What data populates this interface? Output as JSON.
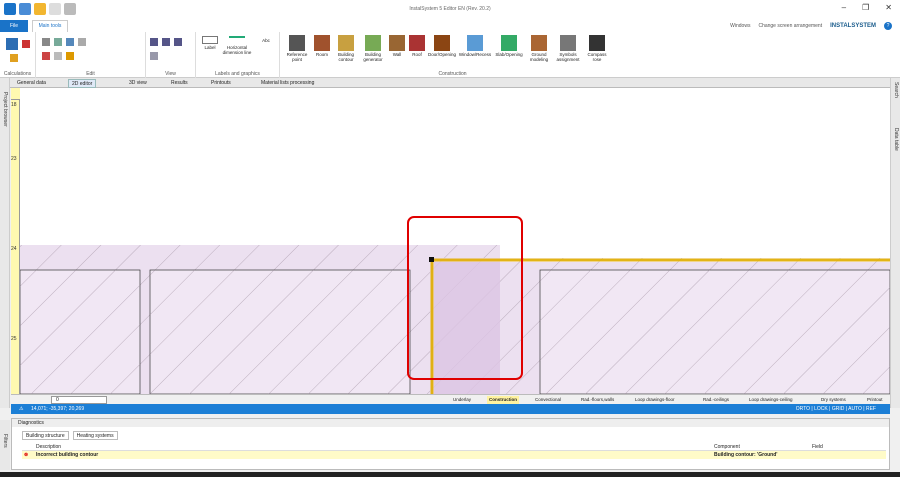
{
  "app": {
    "title": "InstalSystem 5 Editor EN (Rev. 20.2)"
  },
  "menu": {
    "file": "File",
    "main_tools": "Main tools",
    "windows": "Windows",
    "change_arrangement": "Change screen arrangement",
    "brand": "INSTALSYSTEM"
  },
  "ribbon": {
    "groups": [
      "Calculations",
      "Edit",
      "View",
      "Labels and graphics",
      "Construction"
    ],
    "labels_buttons": {
      "label": "Label",
      "hdim": "Horizontal dimension line",
      "abc": "Abc"
    },
    "construction_buttons": [
      "Reference point",
      "Room",
      "Building contour",
      "Building generator",
      "Wall",
      "Roof",
      "Door/Opening",
      "Window/Recess",
      "Slab/Opening",
      "Ground modeling",
      "Symbols assignment",
      "Compass rose"
    ]
  },
  "doc_tabs": [
    "General data",
    "2D editor",
    "3D view",
    "Results",
    "Printouts",
    "Material lists processing"
  ],
  "side_panels": {
    "left": "Project browser",
    "right_search": "Search",
    "right_data": "Data table"
  },
  "ruler": {
    "top_numbers": [
      "7",
      "8",
      "9",
      "10",
      "11",
      "12",
      "13",
      "14",
      "15"
    ],
    "left_numbers": [
      "18",
      "23",
      "24",
      "25"
    ]
  },
  "layers": [
    "Underlay",
    "Construction",
    "Convectional",
    "Rad.-floors,walls",
    "Loop drawings-floor",
    "Rad.-ceilings",
    "Loop drawings-ceiling",
    "Dry systems",
    "Printout"
  ],
  "level_select": "0",
  "coords": "14,071; -35,397; 20,269",
  "modes": "ORTO | LOCK | GRID | AUTO | REF",
  "diagnostics": {
    "title": "Diagnostics",
    "tabs": [
      "Building structure",
      "Heating systems"
    ],
    "columns": [
      "Description",
      "Component",
      "Field"
    ],
    "rows": [
      {
        "description": "Incorrect building contour",
        "component": "Building contour: 'Ground'",
        "field": ""
      }
    ],
    "filters": "Filters"
  },
  "colors": {
    "accent": "#1a73c8",
    "status_bar": "#1c7fd6",
    "highlight_red": "#e00000",
    "contour_yellow": "#f5c400",
    "wall_fill": "#e8dcef"
  }
}
